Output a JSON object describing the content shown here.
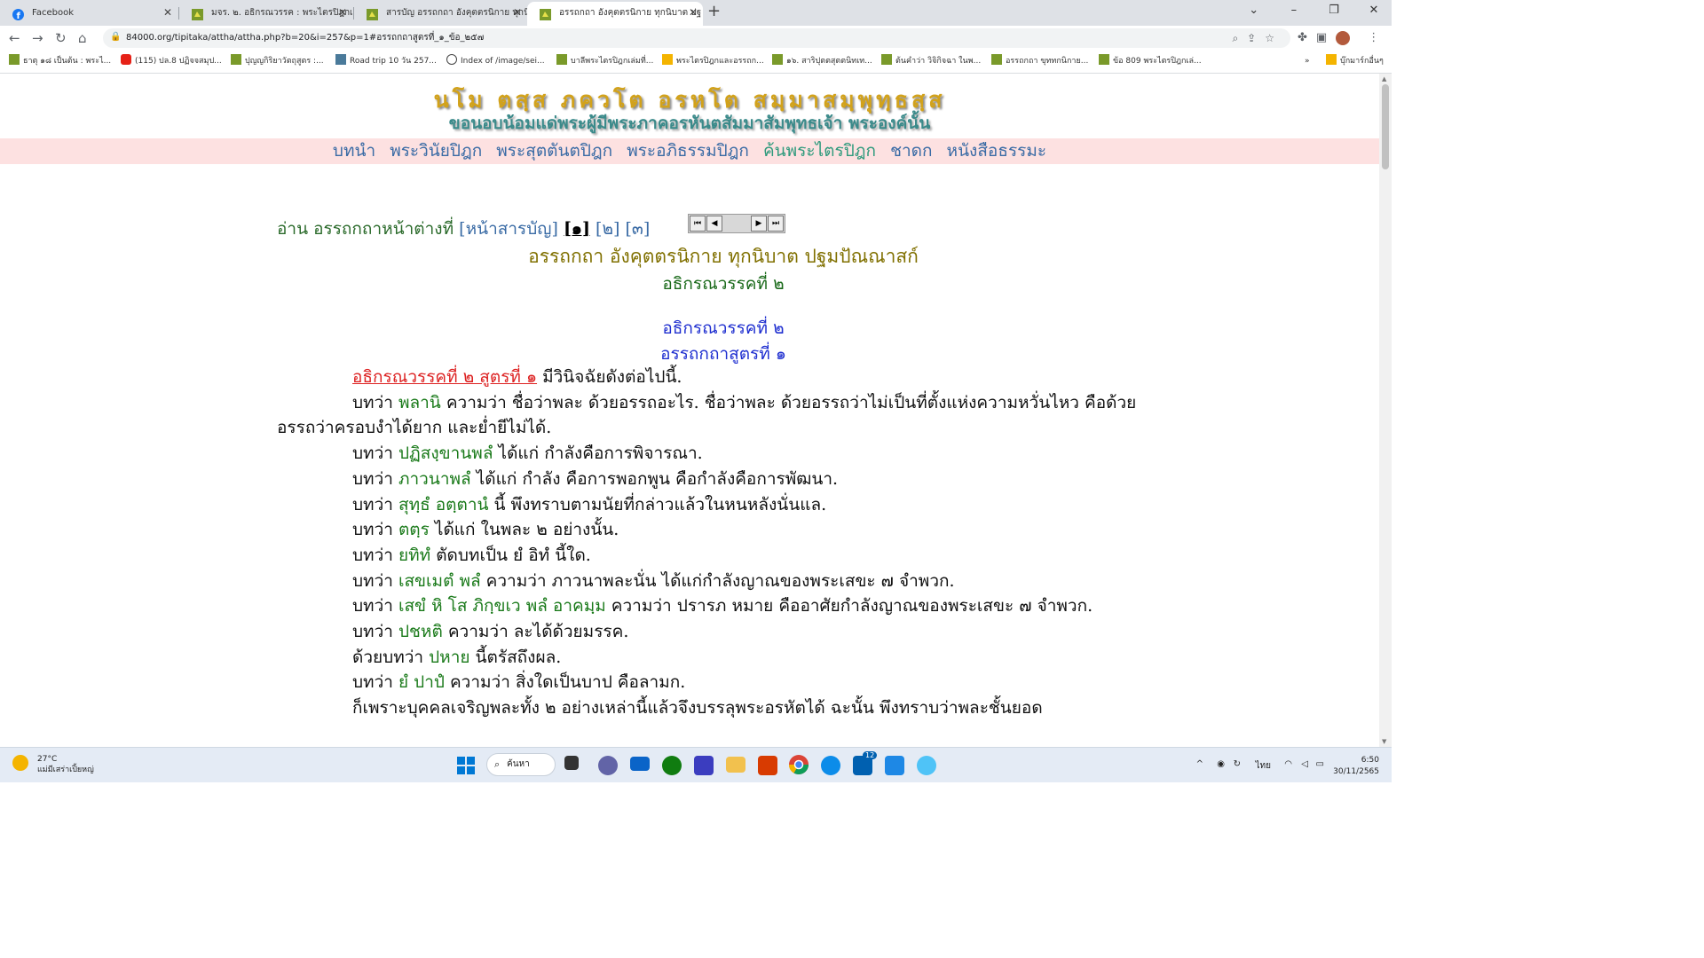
{
  "browser": {
    "tabs": [
      {
        "title": "Facebook",
        "active": false
      },
      {
        "title": "มจร. ๒. อธิกรณวรรค : พระไตรปิฎกเล่ม",
        "active": false
      },
      {
        "title": "สารบัญ อรรถกถา อังคุตตรนิกาย ทุกนิบ",
        "active": false
      },
      {
        "title": "อรรถกถา อังคุตตรนิกาย ทุกนิบาต ปฐ",
        "active": true
      }
    ],
    "url": "84000.org/tipitaka/attha/attha.php?b=20&i=257&p=1#อรรถกถาสูตรที่_๑_ข้อ_๒๕๗",
    "bookmarks": [
      "ธาตุ ๑๘ เป็นต้น : พระไ...",
      "(115) ปล.8 ปฏิจจสมุป...",
      "ปุญญกิริยาวัตถุสูตร :...",
      "Road trip 10 วัน 257...",
      "Index of /image/sei...",
      "บาลีพระไตรปิฎกเล่มที่...",
      "พระไตรปิฎกและอรรถก...",
      "๑๖. สาริปุตตสุตตนิทเท...",
      "ต้นคำว่า วิจิกิจฉา ในพ...",
      "อรรถกถา ขุททกนิกาย...",
      "ข้อ 809 พระไตรปิฎกเล่...",
      "บุ๊กมาร์กอื่นๆ"
    ]
  },
  "page": {
    "banner_pali": "นโม ตสฺส ภควโต อรหโต สมฺมาสมฺพุทฺธสฺส",
    "banner_thai": "ขอนอบน้อมแด่พระผู้มีพระภาคอรหันตสัมมาสัมพุทธเจ้า  พระองค์นั้น",
    "menu": [
      "บทนำ",
      "พระวินัยปิฎก",
      "พระสุตตันตปิฎก",
      "พระอภิธรรมปิฎก",
      "ค้นพระไตรปิฎก",
      "ชาดก",
      "หนังสือธรรมะ"
    ],
    "read_label": "อ่าน อรรถกถาหน้าต่างที่",
    "toc_link": "[หน้าสารบัญ]",
    "page_links": [
      "[๑]",
      "[๒]",
      "[๓]"
    ],
    "title1": "อรรถกถา อังคุตตรนิกาย ทุกนิบาต ปฐมปัณณาสก์",
    "title2": "อธิกรณวรรคที่ ๒",
    "title3": "อธิกรณวรรคที่ ๒",
    "title4": "อรรถกถาสูตรที่ ๑",
    "p1_link": "อธิกรณวรรคที่ ๒ สูตรที่ ๑",
    "p1_rest": " มีวินิจฉัยดังต่อไปนี้.",
    "paragraphs": [
      [
        "บทว่า ",
        "พลานิ",
        " ความว่า ชื่อว่าพละ ด้วยอรรถอะไร. ชื่อว่าพละ ด้วยอรรถว่าไม่เป็นที่ตั้งแห่งความหวั่นไหว คือด้วยอรรถว่าครอบงำได้ยาก และย่ำยีไม่ได้."
      ],
      [
        "บทว่า ",
        "ปฏิสงฺขานพลํ",
        " ได้แก่ กำลังคือการพิจารณา."
      ],
      [
        "บทว่า ",
        "ภาวนาพลํ",
        " ได้แก่ กำลัง คือการพอกพูน คือกำลังคือการพัฒนา."
      ],
      [
        "บทว่า ",
        "สุทฺธํ อตฺตานํ",
        " นี้ พึงทราบตามนัยที่กล่าวแล้วในหนหลังนั่นแล."
      ],
      [
        "บทว่า ",
        "ตตฺร",
        " ได้แก่ ในพละ ๒ อย่างนั้น."
      ],
      [
        "บทว่า ",
        "ยทิทํ",
        " ตัดบทเป็น ยํ อิทํ นี้ใด."
      ],
      [
        "บทว่า ",
        "เสขเมตํ พลํ",
        " ความว่า ภาวนาพละนั่น ได้แก่กำลังญาณของพระเสขะ ๗ จำพวก."
      ],
      [
        "บทว่า ",
        "เสขํ หิ โส ภิกฺขเว พลํ อาคมฺม",
        " ความว่า ปรารภ หมาย คืออาศัยกำลังญาณของพระเสขะ ๗ จำพวก."
      ],
      [
        "บทว่า ",
        "ปชหติ",
        " ความว่า ละได้ด้วยมรรค."
      ],
      [
        "ด้วยบทว่า ",
        "ปหาย",
        " นี้ตรัสถึงผล."
      ],
      [
        "บทว่า ",
        "ยํ ปาปํ",
        " ความว่า สิ่งใดเป็นบาป คือลามก."
      ],
      [
        "",
        "",
        "ก็เพราะบุคคลเจริญพละทั้ง ๒ อย่างเหล่านี้แล้วจึงบรรลุพระอรหัตได้ ฉะนั้น พึงทราบว่าพละชั้นยอด"
      ]
    ]
  },
  "taskbar": {
    "temp": "27°C",
    "weather": "แม่มีเสร่าเปิ้ยหญ่",
    "search": "ค้นหา",
    "lang": "ไทย",
    "time": "6:50",
    "date": "30/11/2565",
    "badge": "12"
  }
}
